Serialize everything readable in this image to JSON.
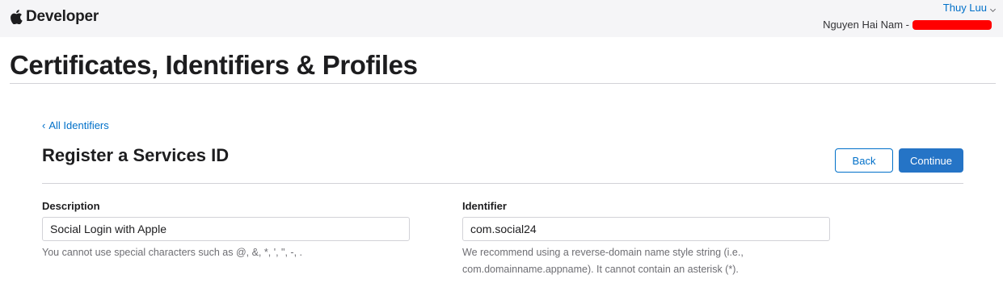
{
  "header": {
    "brand": "Developer",
    "user_name": "Thuy Luu",
    "team_prefix": "Nguyen Hai Nam -"
  },
  "page": {
    "title": "Certificates, Identifiers & Profiles"
  },
  "nav": {
    "back_link": "All Identifiers"
  },
  "section": {
    "title": "Register a Services ID",
    "back_button": "Back",
    "continue_button": "Continue"
  },
  "form": {
    "description": {
      "label": "Description",
      "value": "Social Login with Apple",
      "help": "You cannot use special characters such as @, &, *, ', \", -, ."
    },
    "identifier": {
      "label": "Identifier",
      "value": "com.social24",
      "help": "We recommend using a reverse-domain name style string (i.e., com.domainname.appname). It cannot contain an asterisk (*)."
    }
  },
  "colors": {
    "link": "#0070c9",
    "primary_button": "#2574c6",
    "redaction": "#ff0000",
    "topbar_bg": "#f5f5f7"
  },
  "icons": {
    "brand": "apple-logo-icon",
    "user_menu": "chevron-down-icon",
    "back": "chevron-left-icon"
  }
}
